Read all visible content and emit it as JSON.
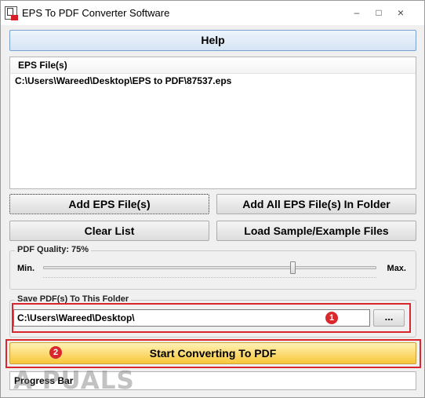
{
  "window": {
    "title": "EPS To PDF Converter Software",
    "controls": {
      "minimize": "–",
      "maximize": "□",
      "close": "×"
    }
  },
  "toolbar": {
    "help_label": "Help"
  },
  "file_list": {
    "header": "EPS File(s)",
    "items": [
      "C:\\Users\\Wareed\\Desktop\\EPS to PDF\\87537.eps"
    ]
  },
  "buttons": {
    "add_files": "Add EPS File(s)",
    "add_folder": "Add All EPS File(s) In Folder",
    "clear_list": "Clear List",
    "load_sample": "Load Sample/Example Files",
    "browse": "...",
    "start": "Start Converting To PDF"
  },
  "quality": {
    "label": "PDF Quality: 75%",
    "min_label": "Min.",
    "max_label": "Max.",
    "value_fraction": 0.75
  },
  "save": {
    "group_label": "Save PDF(s) To This Folder",
    "path": "C:\\Users\\Wareed\\Desktop\\"
  },
  "annotations": {
    "badge_1": "1",
    "badge_2": "2",
    "color": "#d8282d"
  },
  "progress": {
    "label": "Progress Bar",
    "value_fraction": 0
  },
  "watermark": {
    "text": "A PUALS"
  }
}
